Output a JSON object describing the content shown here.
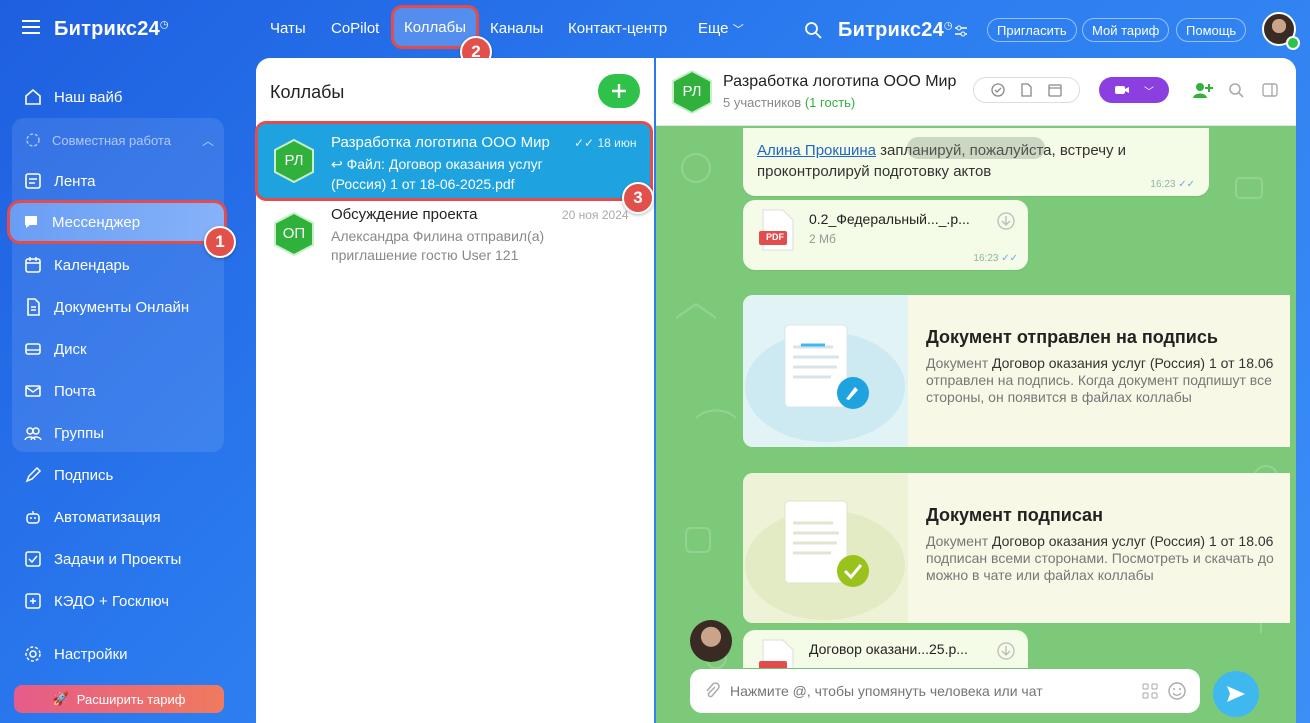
{
  "app": {
    "brand": "Битрикс24",
    "brand_mark": "◷"
  },
  "sidebar": {
    "items": [
      {
        "label": "Наш вайб",
        "icon": "home-icon"
      },
      {
        "label": "Лента",
        "icon": "feed-icon"
      },
      {
        "label": "Мессенджер",
        "icon": "chat-icon"
      },
      {
        "label": "Календарь",
        "icon": "calendar-icon"
      },
      {
        "label": "Документы Онлайн",
        "icon": "document-icon"
      },
      {
        "label": "Диск",
        "icon": "disk-icon"
      },
      {
        "label": "Почта",
        "icon": "mail-icon"
      },
      {
        "label": "Группы",
        "icon": "groups-icon"
      },
      {
        "label": "Подпись",
        "icon": "pen-icon"
      },
      {
        "label": "Автоматизация",
        "icon": "robot-icon"
      },
      {
        "label": "Задачи и Проекты",
        "icon": "tasks-icon"
      },
      {
        "label": "КЭДО + Госключ",
        "icon": "key-icon"
      },
      {
        "label": "Настройки",
        "icon": "gear-icon"
      }
    ],
    "group_label": "Совместная работа",
    "upgrade_label": "Расширить тариф"
  },
  "topnav": {
    "tabs": [
      "Чаты",
      "CoPilot",
      "Коллабы",
      "Каналы",
      "Контакт-центр",
      "Еще"
    ],
    "invite": "Пригласить",
    "plan": "Мой тариф",
    "help": "Помощь"
  },
  "steps": [
    "1",
    "2",
    "3"
  ],
  "list": {
    "title": "Коллабы",
    "chats": [
      {
        "initials": "РЛ",
        "name": "Разработка логотипа ООО Мир",
        "date": "18 июн",
        "preview1": "Файл: Договор оказания услуг",
        "preview2": "(Россия) 1 от 18-06-2025.pdf"
      },
      {
        "initials": "ОП",
        "name": "Обсуждение проекта",
        "date": "20 ноя 2024",
        "preview1": "Александра Филина отправил(а)",
        "preview2": "приглашение гостю User 121"
      }
    ]
  },
  "chat": {
    "initials": "РЛ",
    "title": "Разработка логотипа ООО Мир",
    "participants": "5 участников",
    "guests": "(1 гость)",
    "msg1_author": "Алина Прокшина",
    "msg1_text": " запланируй, пожалуйста, встречу и",
    "msg1_text2": "проконтролируй подготовку актов",
    "msg1_time": "16:23",
    "file1_name": "0.2_Федеральный..._.p...",
    "file1_size": "2 Мб",
    "file1_type": "PDF",
    "file1_time": "16:23",
    "card1_title": "Документ отправлен на подпись",
    "card1_l1a": "Документ ",
    "card1_l1b": "Договор оказания услуг (Россия) 1 от 18.06",
    "card1_l2": "отправлен на подпись. Когда документ подпишут все",
    "card1_l3": "стороны, он появится в файлах коллабы",
    "card2_title": "Документ подписан",
    "card2_l1a": "Документ ",
    "card2_l1b": "Договор оказания услуг (Россия) 1 от 18.06",
    "card2_l2": "подписан всеми сторонами. Посмотреть и скачать до",
    "card2_l3": "можно в чате или файлах коллабы",
    "file2_name": "Договор оказани...25.p...",
    "file2_type": "PDF",
    "input_placeholder": "Нажмите @, чтобы упомянуть человека или чат"
  },
  "colors": {
    "accent": "#2c7df0",
    "green": "#2fc24a",
    "selected": "#1fa3e0",
    "step_badge": "#e2504b",
    "video": "#8b3fe0"
  }
}
